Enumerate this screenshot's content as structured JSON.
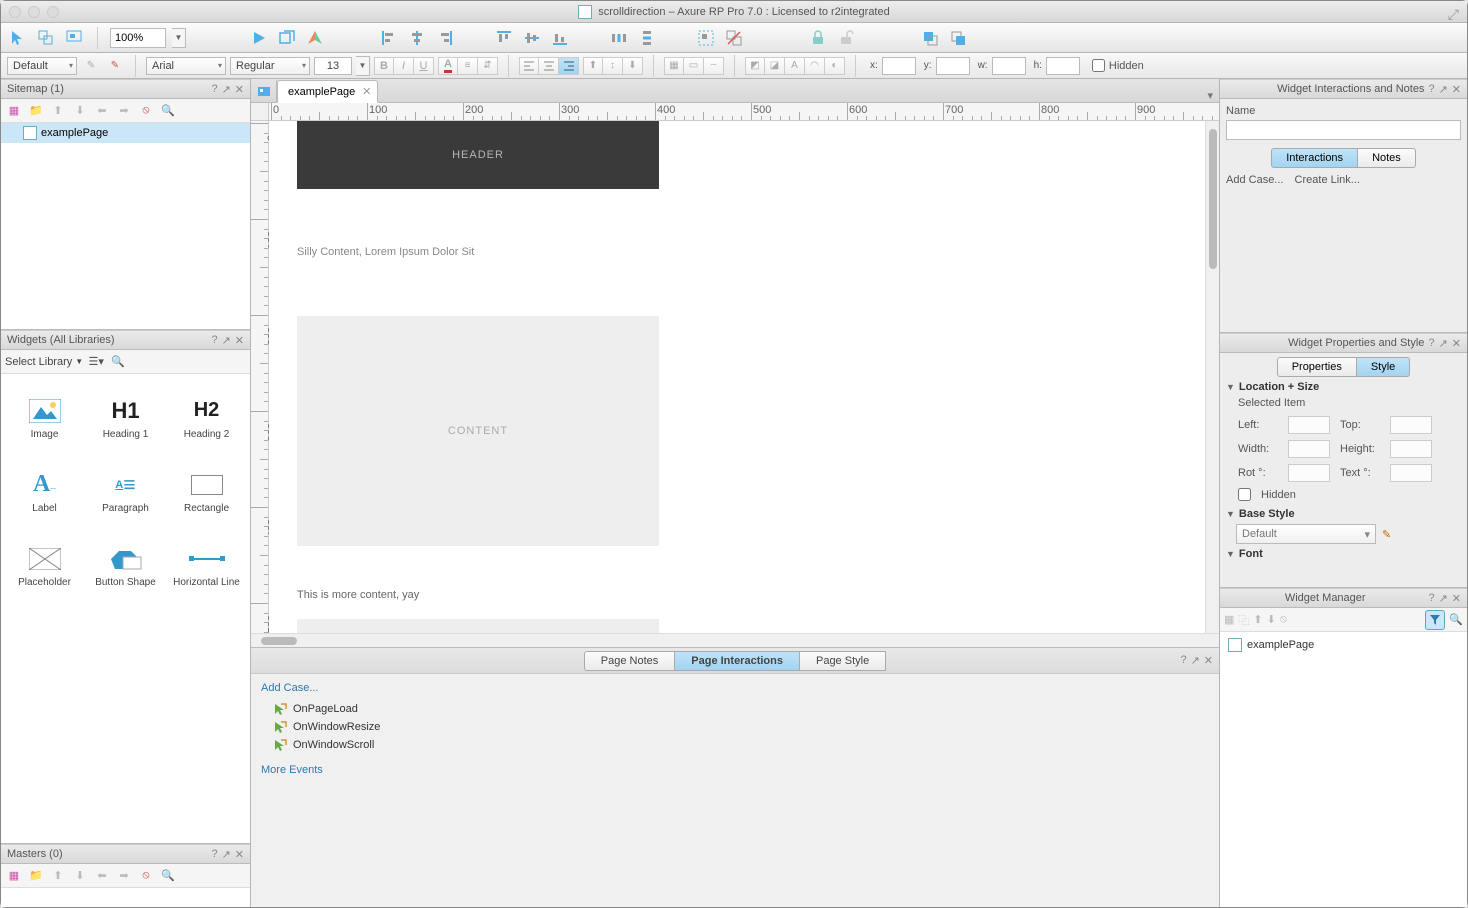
{
  "window": {
    "title": "scrolldirection – Axure RP Pro 7.0 : Licensed to r2integrated"
  },
  "toolbar1": {
    "zoom": "100%"
  },
  "toolbar2": {
    "style_dropdown": "Default",
    "font": "Arial",
    "weight": "Regular",
    "size": "13",
    "coords": {
      "x": "x:",
      "y": "y:",
      "w": "w:",
      "h": "h:"
    },
    "hidden_label": "Hidden"
  },
  "sitemap": {
    "title": "Sitemap (1)",
    "items": [
      "examplePage"
    ]
  },
  "widgets": {
    "title": "Widgets (All Libraries)",
    "select_library": "Select Library",
    "items": [
      "Image",
      "Heading 1",
      "Heading 2",
      "Label",
      "Paragraph",
      "Rectangle",
      "Placeholder",
      "Button Shape",
      "Horizontal Line"
    ]
  },
  "masters": {
    "title": "Masters (0)"
  },
  "tabs": {
    "active": "examplePage"
  },
  "ruler": {
    "h": [
      "0",
      "100",
      "200",
      "300",
      "400",
      "500",
      "600",
      "700",
      "800",
      "900"
    ],
    "v": [
      "0",
      "100",
      "200",
      "300",
      "400",
      "500"
    ]
  },
  "canvas": {
    "header_text": "HEADER",
    "heading_text": "Silly Content, Lorem Ipsum Dolor Sit",
    "content_text": "CONTENT",
    "text2": "This is more content, yay"
  },
  "bottom": {
    "tabs": [
      "Page Notes",
      "Page Interactions",
      "Page Style"
    ],
    "add_case": "Add Case...",
    "events": [
      "OnPageLoad",
      "OnWindowResize",
      "OnWindowScroll"
    ],
    "more_events": "More Events"
  },
  "right": {
    "interactions_panel": {
      "title": "Widget Interactions and Notes",
      "name_label": "Name",
      "tabs": [
        "Interactions",
        "Notes"
      ],
      "links": {
        "add_case": "Add Case...",
        "create_link": "Create Link..."
      }
    },
    "props_panel": {
      "title": "Widget Properties and Style",
      "tabs": [
        "Properties",
        "Style"
      ],
      "loc_size": "Location + Size",
      "selected_item": "Selected Item",
      "left": "Left:",
      "top": "Top:",
      "width": "Width:",
      "height": "Height:",
      "rot": "Rot °:",
      "text_rot": "Text °:",
      "hidden": "Hidden",
      "base_style": "Base Style",
      "base_style_value": "Default",
      "font_section": "Font"
    },
    "manager": {
      "title": "Widget Manager",
      "items": [
        "examplePage"
      ]
    }
  }
}
